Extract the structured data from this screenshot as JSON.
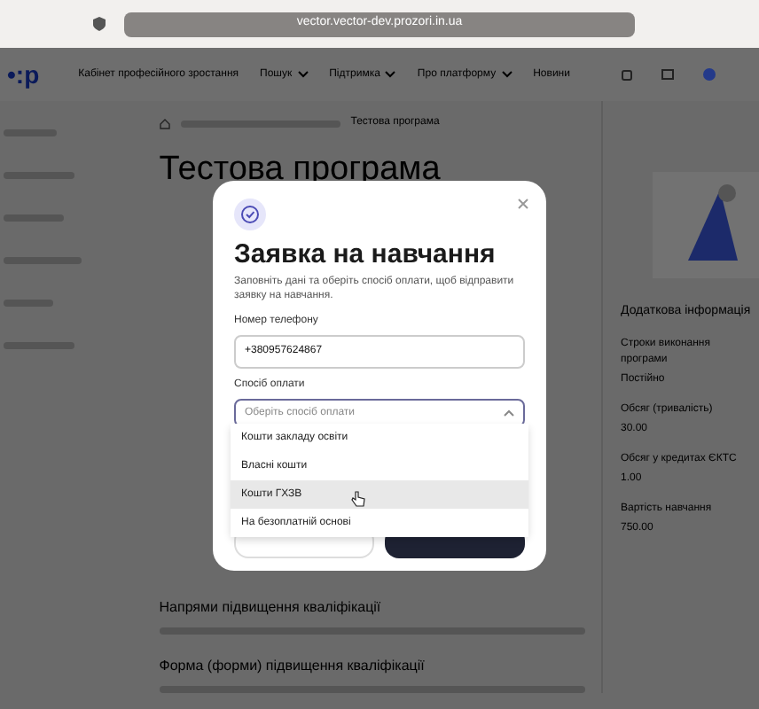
{
  "browser": {
    "url": "vector.vector-dev.prozori.in.ua"
  },
  "nav": {
    "logo": "•:p",
    "items": [
      {
        "label": "Кабінет професійного зростання",
        "has_menu": false
      },
      {
        "label": "Пошук",
        "has_menu": true
      },
      {
        "label": "Підтримка",
        "has_menu": true
      },
      {
        "label": "Про платформу",
        "has_menu": true
      },
      {
        "label": "Новини",
        "has_menu": false
      }
    ]
  },
  "breadcrumb": {
    "current": "Тестова програма"
  },
  "page_title": "Тестова програма",
  "sections": [
    {
      "title": "Напрями підвищення кваліфікації"
    },
    {
      "title": "Форма (форми) підвищення кваліфікації"
    }
  ],
  "side_panel": {
    "title": "Додаткова інформація",
    "items": [
      {
        "label": "Строки виконання програми",
        "value": "Постійно"
      },
      {
        "label": "Обсяг (тривалість)",
        "value": "30.00"
      },
      {
        "label": "Обсяг у кредитах ЄКТС",
        "value": "1.00"
      },
      {
        "label": "Вартість навчання",
        "value": "750.00"
      }
    ]
  },
  "modal": {
    "title": "Заявка на навчання",
    "subtitle": "Заповніть дані та оберіть спосіб оплати, щоб відправити заявку на навчання.",
    "phone": {
      "label": "Номер телефону",
      "value": "+380957624867"
    },
    "payment": {
      "label": "Спосіб оплати",
      "placeholder": "Оберіть спосіб оплати",
      "expanded": true,
      "options": [
        {
          "label": "Кошти закладу освіти",
          "selected": false
        },
        {
          "label": "Власні кошти",
          "selected": false
        },
        {
          "label": "Кошти ГХЗВ",
          "selected": true
        },
        {
          "label": "На безоплатній основі",
          "selected": false
        }
      ]
    }
  }
}
